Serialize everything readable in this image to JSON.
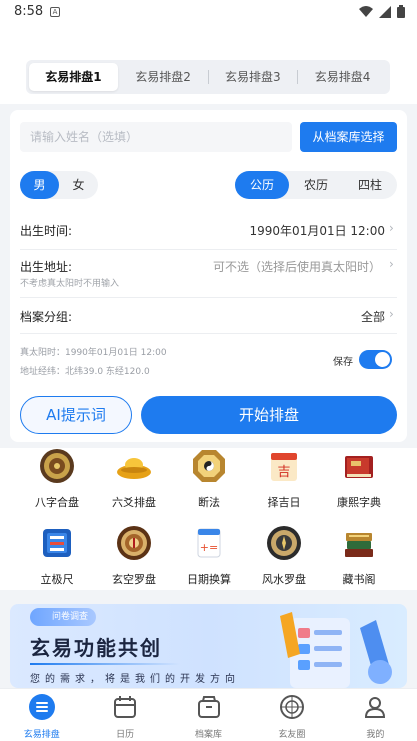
{
  "status_bar": {
    "time": "8:58",
    "notification_glyph": "A"
  },
  "tabs": [
    {
      "label": "玄易排盘1",
      "active": true
    },
    {
      "label": "玄易排盘2",
      "active": false
    },
    {
      "label": "玄易排盘3",
      "active": false
    },
    {
      "label": "玄易排盘4",
      "active": false
    }
  ],
  "form": {
    "name_placeholder": "请输入姓名（选填）",
    "archive_button": "从档案库选择",
    "gender": {
      "male": "男",
      "female": "女",
      "selected": "男"
    },
    "calendar": {
      "solar": "公历",
      "lunar": "农历",
      "pillars": "四柱",
      "selected": "公历"
    },
    "birth_time": {
      "label": "出生时间:",
      "value": "1990年01月01日 12:00"
    },
    "birth_place": {
      "label": "出生地址:",
      "value": "可不选（选择后使用真太阳时）",
      "hint": "不考虑真太阳时不用输入"
    },
    "archive_group": {
      "label": "档案分组:",
      "value": "全部"
    },
    "true_solar_time": "真太阳时：1990年01月01日 12:00",
    "coords": "地址经纬：北纬39.0 东经120.0",
    "save": {
      "label": "保存",
      "on": true
    },
    "ai_button": "AI提示词",
    "start_button": "开始排盘"
  },
  "features": [
    {
      "label": "八字合盘",
      "icon": "bazi-compass-icon"
    },
    {
      "label": "六爻排盘",
      "icon": "gold-ingot-icon"
    },
    {
      "label": "断法",
      "icon": "bagua-icon"
    },
    {
      "label": "择吉日",
      "icon": "calendar-ji-icon"
    },
    {
      "label": "康熙字典",
      "icon": "dictionary-book-icon"
    },
    {
      "label": "立极尺",
      "icon": "ruler-icon"
    },
    {
      "label": "玄空罗盘",
      "icon": "luopan-icon"
    },
    {
      "label": "日期换算",
      "icon": "date-convert-icon"
    },
    {
      "label": "风水罗盘",
      "icon": "fengshui-compass-icon"
    },
    {
      "label": "藏书阁",
      "icon": "books-stack-icon"
    }
  ],
  "banner": {
    "tag": "问卷调查",
    "title": "玄易功能共创",
    "subtitle": "您的需求，将是我们的开发方向"
  },
  "bottom_nav": [
    {
      "label": "玄易排盘",
      "icon": "paipan-icon",
      "active": true
    },
    {
      "label": "日历",
      "icon": "calendar-icon",
      "active": false
    },
    {
      "label": "档案库",
      "icon": "archive-box-icon",
      "active": false
    },
    {
      "label": "玄友圈",
      "icon": "circle-community-icon",
      "active": false
    },
    {
      "label": "我的",
      "icon": "user-icon",
      "active": false
    }
  ],
  "colors": {
    "accent": "#1e7bef",
    "background": "#f2f4f7"
  }
}
